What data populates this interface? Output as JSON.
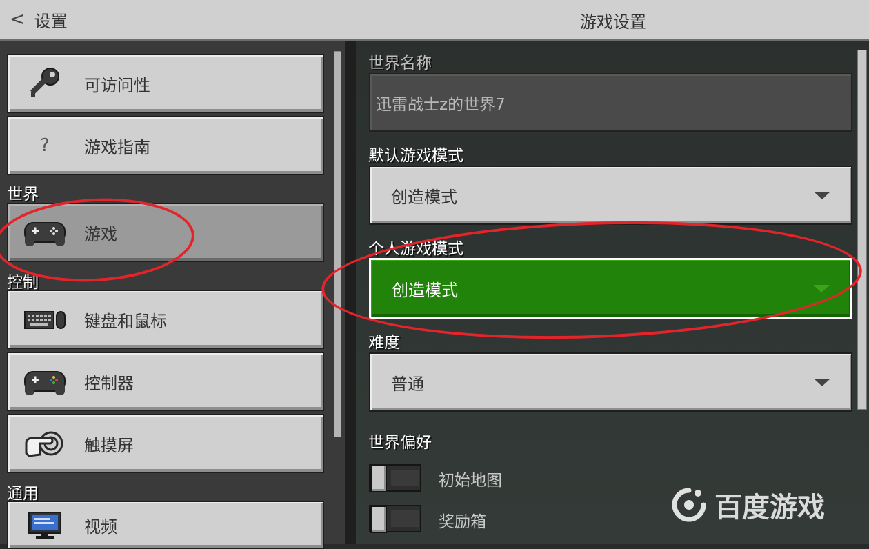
{
  "header": {
    "back_label": "设置",
    "title": "游戏设置"
  },
  "sidebar": {
    "items": [
      {
        "label": "可访问性",
        "icon": "key-icon"
      },
      {
        "label": "游戏指南",
        "icon": "question-icon",
        "glyph": "?"
      },
      {
        "label": "游戏",
        "icon": "gamepad-icon"
      },
      {
        "label": "键盘和鼠标",
        "icon": "keyboard-mouse-icon"
      },
      {
        "label": "控制器",
        "icon": "controller-icon"
      },
      {
        "label": "触摸屏",
        "icon": "touch-icon"
      },
      {
        "label": "视频",
        "icon": "monitor-icon"
      }
    ],
    "sections": {
      "world": "世界",
      "control": "控制",
      "general": "通用"
    },
    "active": "游戏"
  },
  "settings": {
    "world_name_label": "世界名称",
    "world_name_value": "迅雷战士z的世界7",
    "default_mode_label": "默认游戏模式",
    "default_mode_value": "创造模式",
    "personal_mode_label": "个人游戏模式",
    "personal_mode_value": "创造模式",
    "difficulty_label": "难度",
    "difficulty_value": "普通",
    "world_prefs_label": "世界偏好",
    "toggles": [
      {
        "label": "初始地图",
        "on": false
      },
      {
        "label": "奖励箱",
        "on": false
      }
    ]
  },
  "watermark": {
    "text": "百度游戏"
  },
  "colors": {
    "accent_green": "#21830a",
    "annotation_red": "#e4242b"
  }
}
